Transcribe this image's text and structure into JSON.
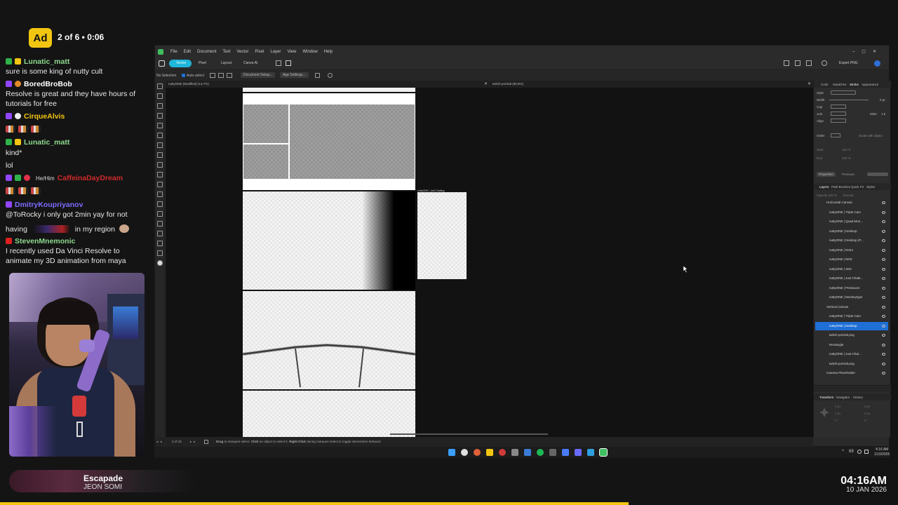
{
  "ad": {
    "label": "Ad",
    "counter": "2 of 6 • 0:06"
  },
  "chat": [
    {
      "user": "Lunatic_matt",
      "color": "#8fd98f",
      "text": "sure is some king of nutty cult"
    },
    {
      "user": "BoredBroBob",
      "color": "#ffffff",
      "text": "Resolve is great and they have hours of",
      "text2": "tutorials for free"
    },
    {
      "user": "CirqueAlvis",
      "color": "#f2c511",
      "text": ""
    },
    {
      "user": "Lunatic_matt",
      "color": "#8fd98f",
      "text": "kind*",
      "text2": "lol"
    },
    {
      "user": "CaffeinaDayDream",
      "color": "#d02a2a",
      "pronoun": "He/Him",
      "text": ""
    },
    {
      "user": "DmitryKoupriyanov",
      "color": "#7b6cff",
      "text": "@ToRocky i only got 2min yay for not",
      "text2": "having",
      "text3": "in my region"
    },
    {
      "user": "StevenMnemonic",
      "color": "#8fd98f",
      "text": "I recently used Da Vinci Resolve to",
      "text2": "animate my 3D animation from maya"
    }
  ],
  "song": {
    "title": "Escapade",
    "artist": "JEON SOMI"
  },
  "clock": {
    "time": "04:16AM",
    "date": "10 JAN 2026"
  },
  "stream_progress": 0.7,
  "app": {
    "menu": [
      "File",
      "Edit",
      "Document",
      "Text",
      "Vector",
      "Pixel",
      "Layer",
      "View",
      "Window",
      "Help"
    ],
    "personas": {
      "vector": "Vector",
      "pixel": "Pixel",
      "layout": "Layout",
      "canva_ai": "Canva AI"
    },
    "export_label": "Export PNG",
    "context": {
      "selection": "No Selection",
      "auto_select": "Auto-select",
      "doc_setup": "Document Setup...",
      "app_settings": "App Settings..."
    },
    "doc_tabs": [
      "nuttyONE (Modified) (13.7%)",
      "twitch-portrait (56.8%)"
    ],
    "artboard_label": "nuttyONE | Just Chatting",
    "status": {
      "page": "3 of 15",
      "hint_drag": "Drag",
      "hint_1": "to marquee select.",
      "hint_click": "Click",
      "hint_2": "an object to select it.",
      "hint_right": "Right-Click",
      "hint_3": "during marquee select to toggle intersection behavior."
    },
    "panel_tabs": {
      "color": "Color",
      "swatches": "Swatches",
      "stroke": "Stroke",
      "appearance": "Appearance"
    },
    "stroke": {
      "style": "Style",
      "width": "Width",
      "width_val": "0 pt",
      "cap": "Cap",
      "join": "Join",
      "mitre": "Mitre",
      "mitre_val": "1.5",
      "align": "Align",
      "order": "Order",
      "scale": "Scale with object",
      "start": "Start",
      "end": "End",
      "pct1": "100 %",
      "pct2": "100 %"
    },
    "properties": {
      "properties": "Properties",
      "pressure": "Pressure"
    },
    "layers_tabs": {
      "layers": "Layers",
      "path_brushes": "Path Brushes",
      "quick_fx": "Quick FX",
      "styles": "Styles"
    },
    "layers_opts": {
      "opacity": "Opacity",
      "opacity_val": "100 %",
      "blend": "Normal"
    },
    "layers": [
      {
        "name": "Horizontal Canvas",
        "selected": false
      },
      {
        "name": "nuttyONE | Triple Cam",
        "selected": false
      },
      {
        "name": "nuttyONE | Quad Mon...",
        "selected": false
      },
      {
        "name": "nuttyONE | Desktop",
        "selected": false
      },
      {
        "name": "nuttyONE | Desktop (P...",
        "selected": false
      },
      {
        "name": "nuttyONE | Retro",
        "selected": false
      },
      {
        "name": "nuttyONE | NDS",
        "selected": false
      },
      {
        "name": "nuttyONE | 3DS",
        "selected": false
      },
      {
        "name": "nuttyONE | Just Chatti...",
        "selected": false
      },
      {
        "name": "nuttyONE | Pentacam",
        "selected": false
      },
      {
        "name": "nuttyONE | Monkeytype",
        "selected": false
      },
      {
        "name": "Vertical Canvas",
        "selected": false
      },
      {
        "name": "nuttyONE | Triple Cam",
        "selected": false
      },
      {
        "name": "nuttyONE | Desktop",
        "selected": true
      },
      {
        "name": "twitch-portrait.png",
        "selected": false
      },
      {
        "name": "Rectangle",
        "selected": false
      },
      {
        "name": "nuttyONE | Just Chat...",
        "selected": false
      },
      {
        "name": "twitch-portrait.png",
        "selected": false
      },
      {
        "name": "Camera Placeholder",
        "selected": false
      }
    ],
    "bottom_tabs": {
      "transform": "Transform",
      "navigator": "Navigator",
      "history": "History"
    },
    "transform_vals": [
      "0 px",
      "0 px",
      "0 px",
      "0 px",
      "0 °",
      "0 °"
    ]
  },
  "taskbar": {
    "time": "4:16 AM",
    "date": "1/10/2026",
    "num": "69"
  }
}
